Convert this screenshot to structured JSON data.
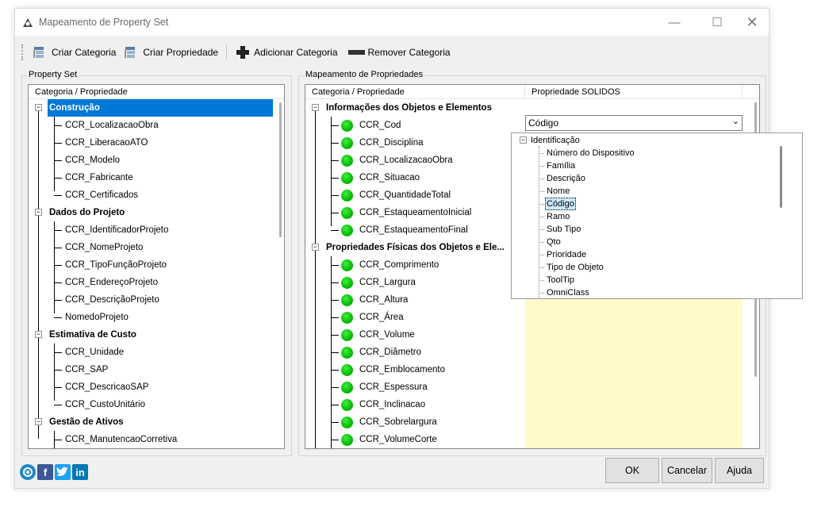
{
  "window": {
    "title": "Mapeamento de Property Set"
  },
  "toolbar": {
    "criar_categoria": "Criar Categoria",
    "criar_propriedade": "Criar Propriedade",
    "adicionar_categoria": "Adicionar Categoria",
    "remover_categoria": "Remover Categoria"
  },
  "left_panel": {
    "group_label": "Property Set",
    "header": "Categoria / Propriedade",
    "categories": [
      {
        "name": "Construção",
        "selected": true,
        "items": [
          "CCR_LocalizacaoObra",
          "CCR_LiberacaoATO",
          "CCR_Modelo",
          "CCR_Fabricante",
          "CCR_Certificados"
        ]
      },
      {
        "name": "Dados do Projeto",
        "items": [
          "CCR_IdentificadorProjeto",
          "CCR_NomeProjeto",
          "CCR_TipoFunçãoProjeto",
          "CCR_EndereçoProjeto",
          "CCR_DescriçãoProjeto",
          "NomedoProjeto"
        ]
      },
      {
        "name": "Estimativa de Custo",
        "items": [
          "CCR_Unidade",
          "CCR_SAP",
          "CCR_DescricaoSAP",
          "CCR_CustoUnitário"
        ]
      },
      {
        "name": "Gestão de Ativos",
        "items": [
          "CCR_ManutencaoCorretiva"
        ]
      }
    ]
  },
  "right_panel": {
    "group_label": "Mapeamento de Propriedades",
    "header_col1": "Categoria / Propriedade",
    "header_col2": "Propriedade SOLIDOS",
    "categories": [
      {
        "name": "Informações dos Objetos e Elementos",
        "items": [
          "CCR_Cod",
          "CCR_Disciplina",
          "CCR_LocalizacaoObra",
          "CCR_Situacao",
          "CCR_QuantidadeTotal",
          "CCR_EstaqueamentoInicial",
          "CCR_EstaqueamentoFinal"
        ]
      },
      {
        "name": "Propriedades Físicas dos Objetos e Ele...",
        "items": [
          "CCR_Comprimento",
          "CCR_Largura",
          "CCR_Altura",
          "CCR_Área",
          "CCR_Volume",
          "CCR_Diâmetro",
          "CCR_Emblocamento",
          "CCR_Espessura",
          "CCR_Inclinacao",
          "CCR_Sobrelargura",
          "CCR_VolumeCorte"
        ]
      }
    ],
    "combo_value": "Código",
    "dropdown": {
      "root": "Identificação",
      "items": [
        "Número do Dispositivo",
        "Família",
        "Descrição",
        "Nome",
        "Código",
        "Ramo",
        "Sub Tipo",
        "Qto",
        "Prioridade",
        "Tipo de Objeto",
        "ToolTip",
        "OmniClass"
      ],
      "selected": "Código"
    }
  },
  "buttons": {
    "ok": "OK",
    "cancel": "Cancelar",
    "help": "Ajuda"
  },
  "social": {
    "facebook": "f",
    "linkedin": "in"
  }
}
